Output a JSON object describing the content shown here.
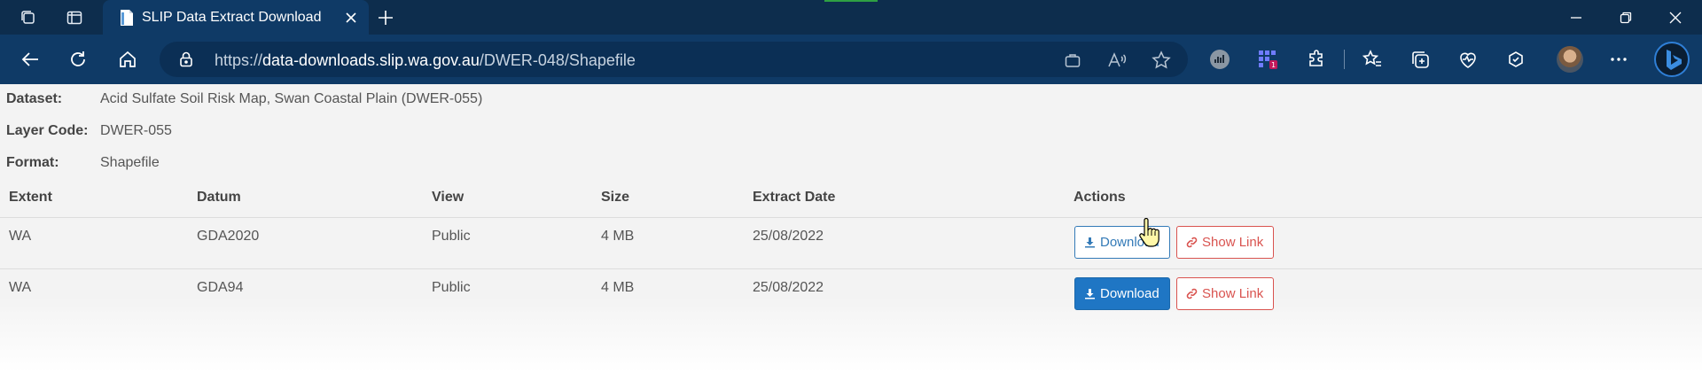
{
  "browser": {
    "tab_title": "SLIP Data Extract Download",
    "url_prefix": "https://",
    "url_host": "data-downloads.slip.wa.gov.au",
    "url_path": "/DWER-048/Shapefile"
  },
  "meta": {
    "dataset_label": "Dataset:",
    "dataset_value": "Acid Sulfate Soil Risk Map, Swan Coastal Plain (DWER-055)",
    "layer_label": "Layer Code:",
    "layer_value": "DWER-055",
    "format_label": "Format:",
    "format_value": "Shapefile"
  },
  "table": {
    "headers": [
      "Extent",
      "Datum",
      "View",
      "Size",
      "Extract Date",
      "Actions"
    ],
    "rows": [
      {
        "extent": "WA",
        "datum": "GDA2020",
        "view": "Public",
        "size": "4 MB",
        "date": "25/08/2022",
        "download": "Download",
        "show_link": "Show Link"
      },
      {
        "extent": "WA",
        "datum": "GDA94",
        "view": "Public",
        "size": "4 MB",
        "date": "25/08/2022",
        "download": "Download",
        "show_link": "Show Link"
      }
    ]
  },
  "colors": {
    "titlebar": "#0d2d4d",
    "toolbar": "#0f3a66",
    "primary": "#337ab7",
    "danger": "#d9534f"
  }
}
